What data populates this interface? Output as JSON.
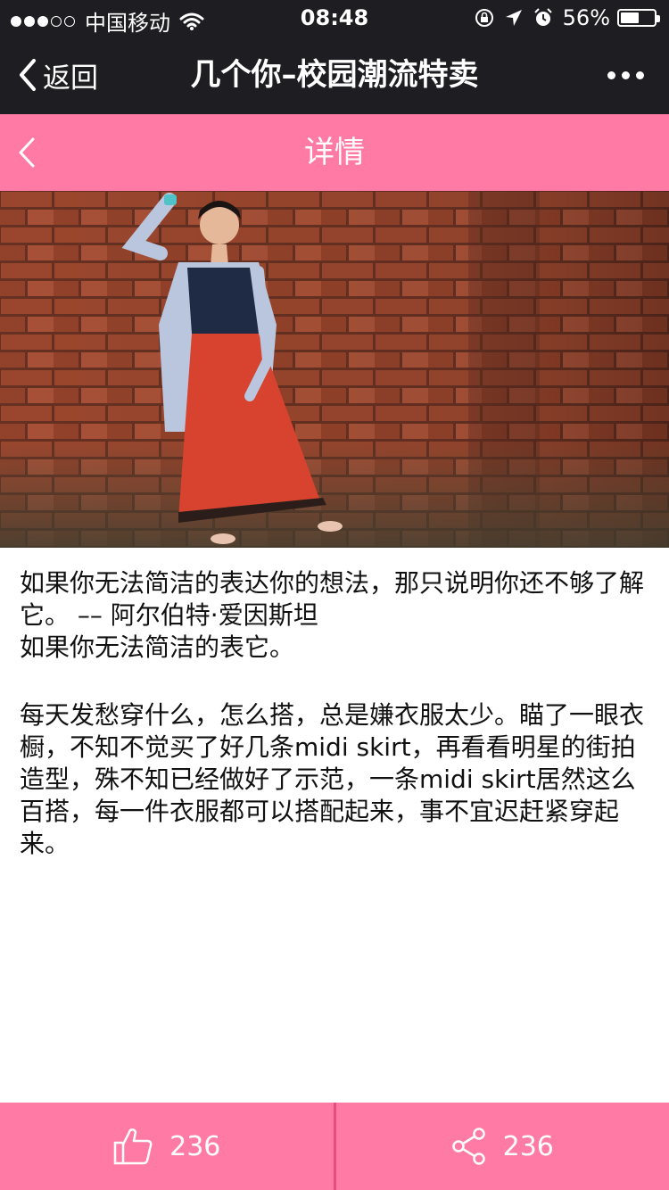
{
  "status_bar": {
    "carrier": "中国移动",
    "time": "08:48",
    "battery": "56%",
    "battery_level": 0.56,
    "signal_strength": 3,
    "signal_max": 5
  },
  "nav": {
    "back_label": "返回",
    "title": "几个你–校园潮流特卖"
  },
  "detail_header": {
    "title": "详情"
  },
  "article": {
    "quote_line1": "如果你无法简洁的表达你的想法，那只说明你还不够了解它。 –– 阿尔伯特·爱因斯坦",
    "quote_line2": "如果你无法简洁的表它。",
    "body": "每天发愁穿什么，怎么搭，总是嫌衣服太少。瞄了一眼衣橱，不知不觉买了好几条midi skirt，再看看明星的街拍造型，殊不知已经做好了示范，一条midi skirt居然这么百搭，每一件衣服都可以搭配起来，事不宜迟赶紧穿起来。"
  },
  "bottom_bar": {
    "like_count": "236",
    "share_count": "236"
  },
  "colors": {
    "nav_bg": "#1e1e22",
    "accent_pink": "#ff7aa4",
    "divider_pink": "#e84d80"
  },
  "icons": {
    "back": "chevron-left-icon",
    "more": "more-dots-icon",
    "like": "thumbs-up-icon",
    "share": "share-icon"
  }
}
